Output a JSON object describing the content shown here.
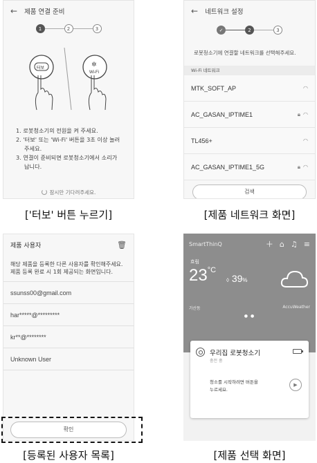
{
  "panel1": {
    "title": "제품 연결 준비",
    "steps": [
      "1",
      "2",
      "3"
    ],
    "instructions": [
      "1. 로봇청소기의 전원을 켜 주세요.",
      "2. '터보' 또는 'Wi-Fi' 버튼을 3초 이상 눌러 주세요.",
      "3. 연결이 준비되면 로봇청소기에서 소리가 납니다."
    ],
    "turbo_label": "터보",
    "wifi_label": "Wi-Fi",
    "waiting": "잠시만 기다려주세요.",
    "caption": "['터보' 버튼 누르기]"
  },
  "panel2": {
    "title": "네트워크 설정",
    "steps": [
      "✓",
      "2",
      "3"
    ],
    "subtitle": "로봇청소기에 연결할 네트워크를 선택해주세요.",
    "section_label": "Wi-Fi 네트워크",
    "networks": [
      {
        "name": "MTK_SOFT_AP",
        "locked": false
      },
      {
        "name": "AC_GASAN_IPTIME1",
        "locked": true
      },
      {
        "name": "TL456+",
        "locked": false
      },
      {
        "name": "AC_GASAN_IPTIME1_5G",
        "locked": true
      }
    ],
    "search_button": "검색",
    "caption": "[제품 네트워크 화면]"
  },
  "panel3": {
    "title": "제품 사용자",
    "subtitle_lines": [
      "해당 제품을 등록한 다른 사용자를 확인해주세요.",
      "제품 등록 완료 시 1회 제공되는 화면입니다."
    ],
    "users": [
      "ssunss00@gmail.com",
      "har*****@*********",
      "kr**@********",
      "Unknown User"
    ],
    "confirm_button": "확인",
    "caption": "[등록된 사용자 목록]"
  },
  "panel4": {
    "app_title": "SmartThinQ",
    "weather": "흐림",
    "temperature": "23",
    "temp_unit": "°C",
    "humidity": "39",
    "humidity_unit": "%",
    "location": "가산동",
    "provider": "AccuWeather",
    "device_name": "우리집 로봇청소기",
    "device_status": "충전 중",
    "message_lines": [
      "청소를 시작하려면 버튼을",
      "누르세요."
    ],
    "caption": "[제품 선택 화면]"
  }
}
